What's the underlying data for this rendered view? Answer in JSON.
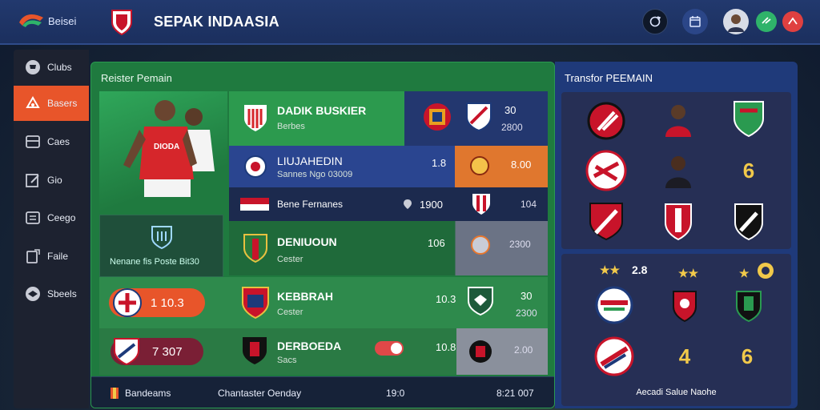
{
  "topbar": {
    "logo_text": "Beisei",
    "app_title": "SEPAK INDAASIA",
    "icons": [
      "refresh-icon",
      "calendar-icon",
      "avatar",
      "whistle-icon",
      "alert-icon"
    ]
  },
  "sidebar": {
    "items": [
      {
        "label": "Clubs",
        "icon": "trophy-icon"
      },
      {
        "label": "Basers",
        "icon": "whistle-icon"
      },
      {
        "label": "Caes",
        "icon": "kit-icon"
      },
      {
        "label": "Gio",
        "icon": "edit-icon"
      },
      {
        "label": "Ceego",
        "icon": "list-icon"
      },
      {
        "label": "Faile",
        "icon": "clipboard-icon"
      },
      {
        "label": "Sbeels",
        "icon": "ball-icon"
      }
    ]
  },
  "roster": {
    "title": "Reister Pemain",
    "hero_shirt": "DIODA",
    "promo_text": "Nenane fis Poste Bit30",
    "rows": [
      {
        "name": "DADIK BUSKIER",
        "sub": "Berbes",
        "val1": "30",
        "val2": "2800"
      },
      {
        "name": "LIUJAHEDIN",
        "sub": "Sannes Ngo 03009",
        "val1": "1.8",
        "val2": "8.00"
      },
      {
        "name": "Bene Fernanes",
        "sub": "",
        "val1": "1900",
        "val2": "104"
      },
      {
        "name": "DENIUOUN",
        "sub": "Cester",
        "val1": "106",
        "val2": "2300"
      },
      {
        "name": "KEBBRAH",
        "sub": "Cester",
        "val1": "10.3",
        "val2": "30",
        "val3": "2300",
        "badge": "1  10.3"
      },
      {
        "name": "DERBOEDA",
        "sub": "Sacs",
        "val1": "10.8",
        "val2": "2.00",
        "badge": "7  307"
      }
    ],
    "bottom": {
      "left": "Bandeams",
      "mid": "Chantaster Oenday",
      "num": "19:0",
      "right": "8:21 007"
    }
  },
  "transfer": {
    "title": "Transfor PEEMAIN",
    "top_numbers": [
      "6"
    ],
    "rating": "2.8",
    "bottom_numbers": [
      "4",
      "6"
    ],
    "footer": "Aecadi Salue Naohe"
  },
  "colors": {
    "accent": "#e8552a",
    "roster_green": "#1f7a3f",
    "navy": "#1f3a7a",
    "gold": "#f1c94a"
  }
}
